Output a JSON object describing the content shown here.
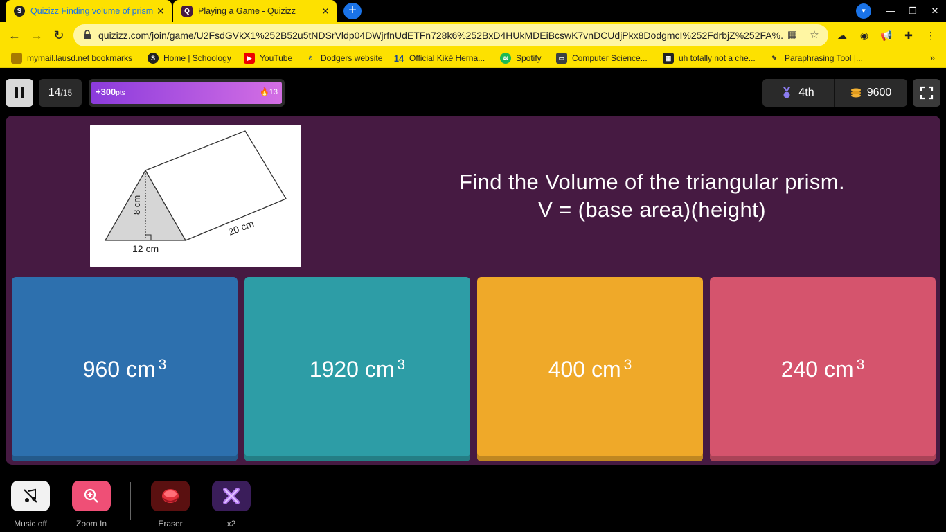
{
  "browser": {
    "tabs": [
      {
        "title": "Quizizz Finding volume of prism",
        "favicon": "S"
      },
      {
        "title": "Playing a Game - Quizizz",
        "favicon": "Q"
      }
    ],
    "url": "quizizz.com/join/game/U2FsdGVkX1%252B52u5tNDSrVldp04DWjrfnUdETFn728k6%252BxD4HUkMDEiBcswK7vnDCUdjPkx8DodgmcI%252FdrbjZ%252FA%...",
    "bookmarks": [
      {
        "label": "mymail.lausd.net bookmarks",
        "icon": "folder-icon"
      },
      {
        "label": "Home | Schoology",
        "icon": "schoology-icon"
      },
      {
        "label": "YouTube",
        "icon": "youtube-icon"
      },
      {
        "label": "Dodgers website",
        "icon": "dodgers-icon"
      },
      {
        "label": "Official Kiké Herna...",
        "icon": "kike-icon"
      },
      {
        "label": "Spotify",
        "icon": "spotify-icon"
      },
      {
        "label": "Computer Science...",
        "icon": "classroom-icon"
      },
      {
        "label": "uh totally not a che...",
        "icon": "grid-icon"
      },
      {
        "label": "Paraphrasing Tool |...",
        "icon": "pencil-icon"
      }
    ],
    "more_bookmarks": "»",
    "accent": "#fde100"
  },
  "game": {
    "question_number": "14",
    "question_total": "/15",
    "streak_points": "+300",
    "streak_points_unit": "pts",
    "streak_count": "13",
    "rank": "4th",
    "score": "9600",
    "question": {
      "line1": "Find the Volume of the triangular prism.",
      "line2": "V = (base area)(height)"
    },
    "figure": {
      "height_label": "8 cm",
      "base_label": "12 cm",
      "length_label": "20 cm"
    },
    "options": [
      {
        "value": "960 cm",
        "exp": "3",
        "color": "#2d70ae"
      },
      {
        "value": "1920 cm",
        "exp": "3",
        "color": "#2d9da6"
      },
      {
        "value": "400 cm",
        "exp": "3",
        "color": "#efa929"
      },
      {
        "value": "240 cm",
        "exp": "3",
        "color": "#d5546d"
      }
    ],
    "powerups": [
      {
        "label": "Music off",
        "icon": "music-off-icon"
      },
      {
        "label": "Zoom In",
        "icon": "zoom-in-icon"
      },
      {
        "label": "Eraser",
        "icon": "eraser-icon"
      },
      {
        "label": "x2",
        "icon": "double-points-icon"
      }
    ],
    "panel_color": "#461a42"
  }
}
